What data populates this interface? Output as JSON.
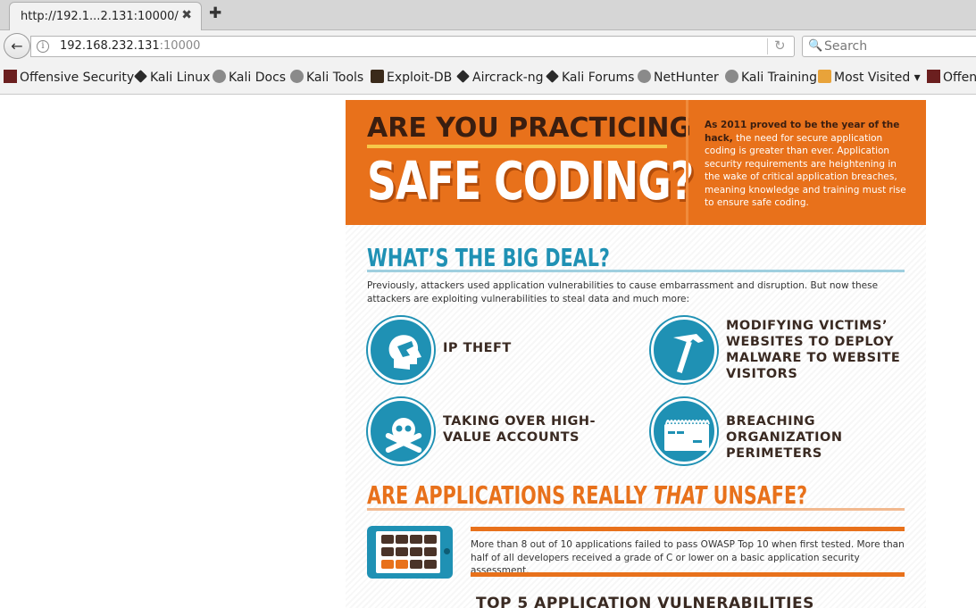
{
  "browser": {
    "tab_title": "http://192.1...2.131:10000/",
    "url_host": "192.168.232.131",
    "url_port": ":10000",
    "search_placeholder": "Search",
    "bookmarks": [
      {
        "label": "Offensive Security",
        "icon": "offsec-icon"
      },
      {
        "label": "Kali Linux",
        "icon": "kali-icon"
      },
      {
        "label": "Kali Docs",
        "icon": "globe-icon"
      },
      {
        "label": "Kali Tools",
        "icon": "globe-icon"
      },
      {
        "label": "Exploit-DB",
        "icon": "exploitdb-icon"
      },
      {
        "label": "Aircrack-ng",
        "icon": "aircrack-icon"
      },
      {
        "label": "Kali Forums",
        "icon": "kali-icon"
      },
      {
        "label": "NetHunter",
        "icon": "globe-icon"
      },
      {
        "label": "Kali Training",
        "icon": "globe-icon"
      },
      {
        "label": "Most Visited ▾",
        "icon": "folder-icon"
      },
      {
        "label": "Offen",
        "icon": "offsec-icon"
      }
    ]
  },
  "infographic": {
    "hero_line1": "ARE YOU PRACTICING",
    "hero_line2": "SAFE CODING?",
    "hero_desc_bold": "As 2011 proved to be the year of the hack,",
    "hero_desc_rest": " the need for secure application coding is greater than ever. Application security requirements are heightening in the wake of critical application breaches, meaning knowledge and training must rise to ensure safe coding.",
    "section1_title": "WHAT’S THE BIG DEAL?",
    "section1_intro": "Previously, attackers used application vulnerabilities to cause embarrassment and disruption. But now these attackers are exploiting vulnerabilities to steal data and much more:",
    "threats": [
      {
        "label": "IP THEFT",
        "icon": "head-hand-icon"
      },
      {
        "label": "MODIFYING VICTIMS’ WEBSITES TO DEPLOY MALWARE TO WEBSITE VISITORS",
        "icon": "hammer-icon"
      },
      {
        "label": "TAKING OVER HIGH-VALUE ACCOUNTS",
        "icon": "skull-crossbones-icon"
      },
      {
        "label": "BREACHING ORGANIZATION PERIMETERS",
        "icon": "brick-wall-icon"
      }
    ],
    "section2_title_a": "ARE APPLICATIONS REALLY ",
    "section2_title_em": "THAT",
    "section2_title_b": " UNSAFE?",
    "section2_stat": "More than 8 out of 10 applications failed to pass OWASP Top 10 when first tested. More than half of all developers received a grade of C or lower on a basic application security assessment.",
    "section3_title": "TOP 5 APPLICATION VULNERABILITIES"
  },
  "colors": {
    "orange": "#e8711b",
    "blue": "#1f91b4",
    "dark_brown": "#3a1e10",
    "yellow": "#f6c84a"
  }
}
